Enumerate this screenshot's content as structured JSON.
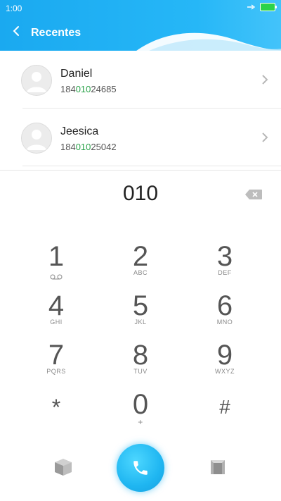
{
  "status_bar": {
    "time": "1:00"
  },
  "header": {
    "title": "Recentes"
  },
  "contacts": [
    {
      "name": "Daniel",
      "phone_prefix": "184",
      "phone_match": "010",
      "phone_suffix": "24685"
    },
    {
      "name": "Jeesica",
      "phone_prefix": "184",
      "phone_match": "010",
      "phone_suffix": "25042"
    }
  ],
  "dialer": {
    "entered": "010"
  },
  "keypad": [
    {
      "digit": "1",
      "letters": ""
    },
    {
      "digit": "2",
      "letters": "ABC"
    },
    {
      "digit": "3",
      "letters": "DEF"
    },
    {
      "digit": "4",
      "letters": "GHI"
    },
    {
      "digit": "5",
      "letters": "JKL"
    },
    {
      "digit": "6",
      "letters": "MNO"
    },
    {
      "digit": "7",
      "letters": "PQRS"
    },
    {
      "digit": "8",
      "letters": "TUV"
    },
    {
      "digit": "9",
      "letters": "WXYZ"
    },
    {
      "digit": "*",
      "letters": ""
    },
    {
      "digit": "0",
      "letters": "+"
    },
    {
      "digit": "#",
      "letters": ""
    }
  ],
  "colors": {
    "header": "#1aa9f0",
    "match_highlight": "#2aa34a",
    "call_button": "#1fb6f1"
  },
  "icons": [
    "back-chevron-icon",
    "battery-icon",
    "voicemail-icon",
    "backspace-icon",
    "call-icon",
    "cube-icon"
  ]
}
